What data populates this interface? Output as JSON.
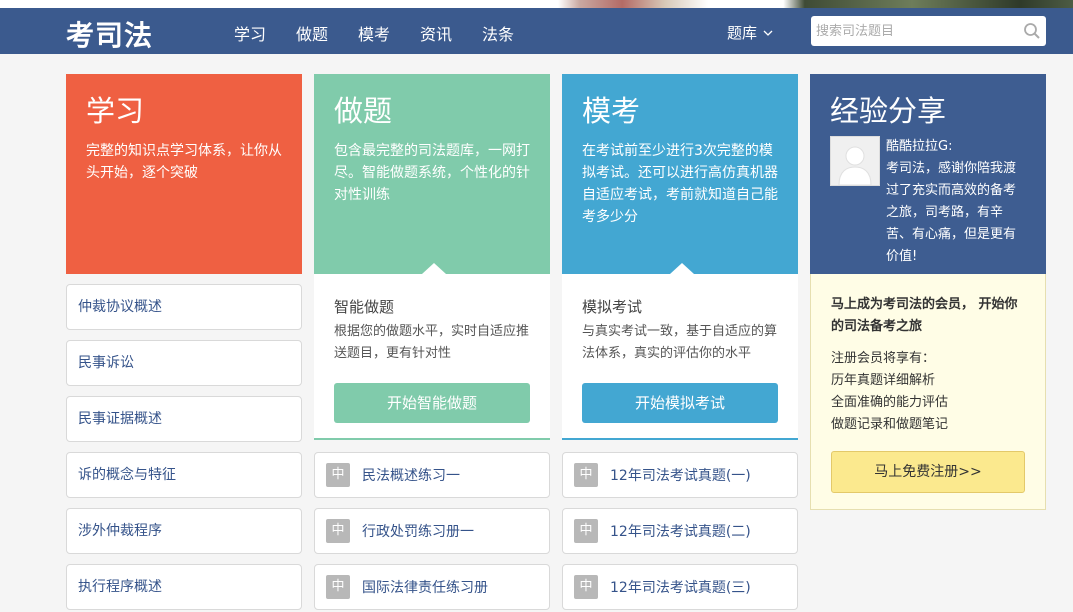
{
  "header": {
    "logo": "考司法",
    "nav": [
      "学习",
      "做题",
      "模考",
      "资讯",
      "法条"
    ],
    "tiku_label": "题库",
    "search_placeholder": "搜索司法题目"
  },
  "study": {
    "title": "学习",
    "desc": "完整的知识点学习体系，让你从头开始，逐个突破",
    "items": [
      "仲裁协议概述",
      "民事诉讼",
      "民事证据概述",
      "诉的概念与特征",
      "涉外仲裁程序",
      "执行程序概述"
    ]
  },
  "practice": {
    "title": "做题",
    "desc": "包含最完整的司法题库，一网打尽。智能做题系统，个性化的针对性训练",
    "panel_title": "智能做题",
    "panel_desc": "根据您的做题水平，实时自适应推送题目，更有针对性",
    "button": "开始智能做题",
    "tag": "中",
    "items": [
      "民法概述练习一",
      "行政处罚练习册一",
      "国际法律责任练习册"
    ]
  },
  "exam": {
    "title": "模考",
    "desc": "在考试前至少进行3次完整的模拟考试。还可以进行高仿真机器自适应考试，考前就知道自己能考多少分",
    "panel_title": "模拟考试",
    "panel_desc": "与真实考试一致，基于自适应的算法体系，真实的评估你的水平",
    "button": "开始模拟考试",
    "tag": "中",
    "items": [
      "12年司法考试真题(一)",
      "12年司法考试真题(二)",
      "12年司法考试真题(三)"
    ]
  },
  "share": {
    "title": "经验分享",
    "user": "酷酷拉拉G:",
    "text": "考司法，感谢你陪我渡过了充实而高效的备考之旅，司考路，有辛苦、有心痛，但是更有价值!"
  },
  "member": {
    "heading": "马上成为考司法的会员， 开始你的司法备考之旅",
    "intro": "注册会员将享有：",
    "features": [
      "历年真题详细解析",
      "全面准确的能力评估",
      "做题记录和做题笔记"
    ],
    "register_button": "马上免费注册>>"
  },
  "colors": {
    "header": "#3b5a8e",
    "study": "#ef6042",
    "practice": "#80cbab",
    "exam": "#43a7d2",
    "share": "#3e5d91"
  }
}
